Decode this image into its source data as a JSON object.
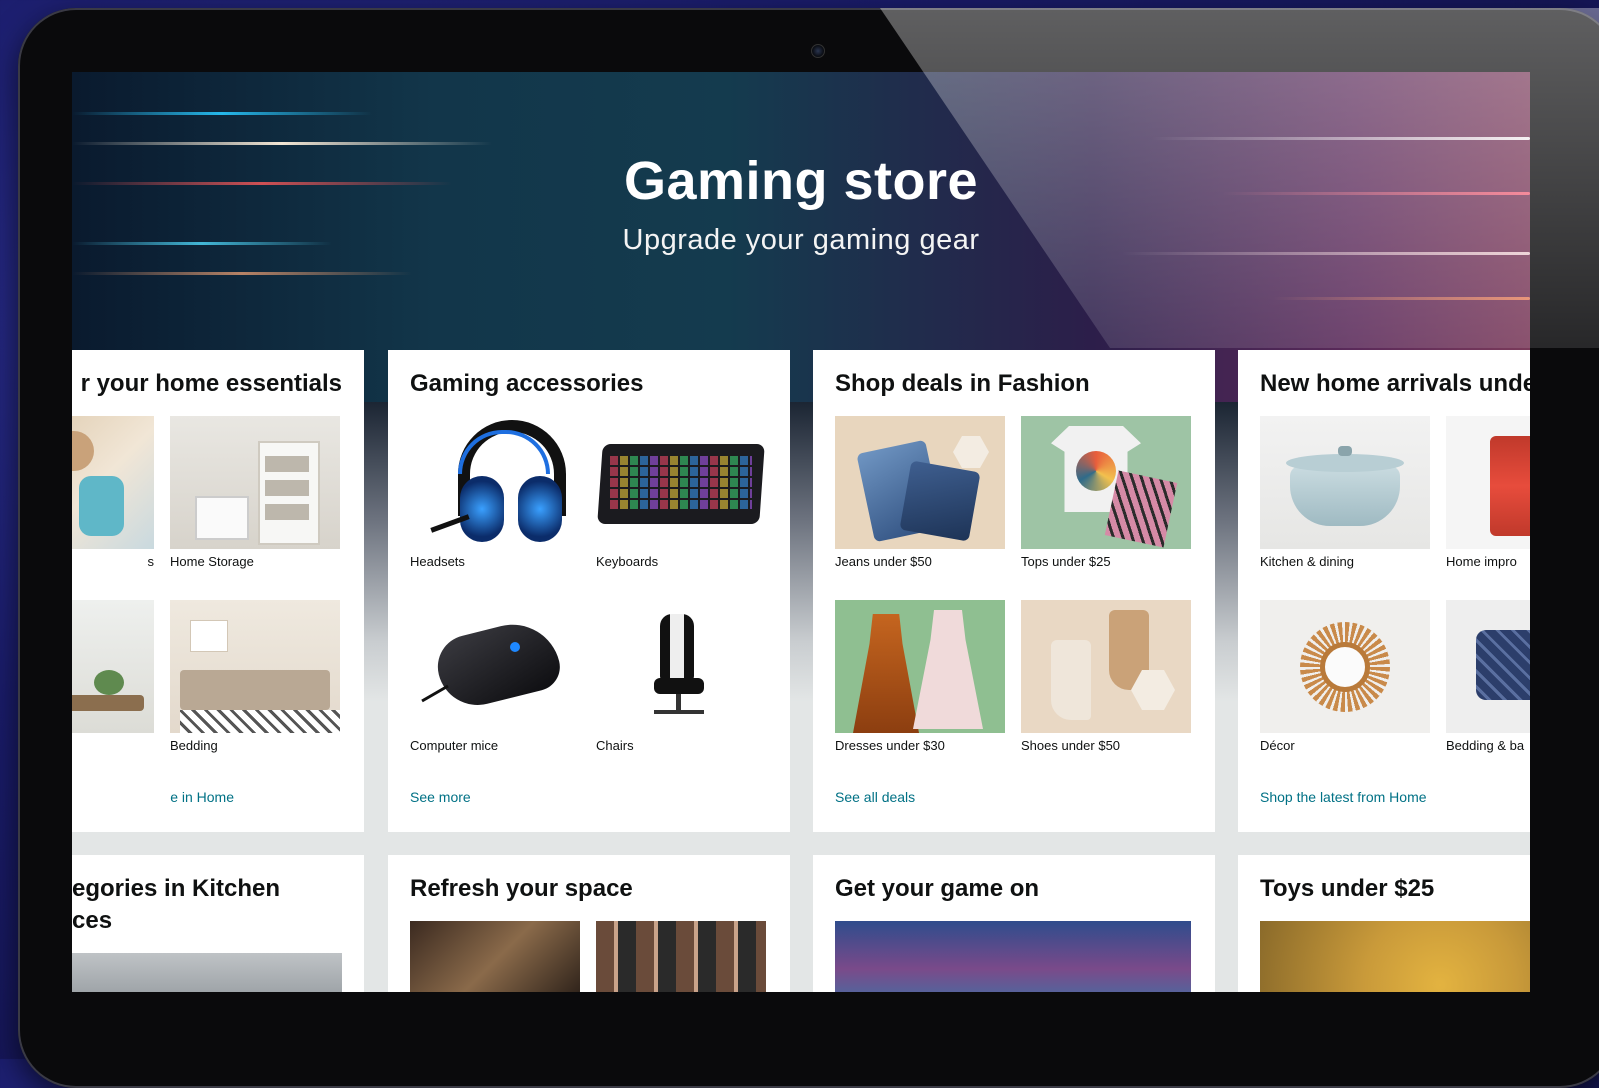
{
  "hero": {
    "title": "Gaming store",
    "subtitle": "Upgrade your gaming gear"
  },
  "cards_row1": [
    {
      "title": "r your home essentials",
      "tiles": [
        {
          "label": "s",
          "icon": "cleaning-image"
        },
        {
          "label": "Home Storage",
          "icon": "storage-shelves-image"
        },
        {
          "label": "",
          "icon": "plant-decor-image"
        },
        {
          "label": "Bedding",
          "icon": "bed-image"
        }
      ],
      "link": "e in Home"
    },
    {
      "title": "Gaming accessories",
      "tiles": [
        {
          "label": "Headsets",
          "icon": "headset-image"
        },
        {
          "label": "Keyboards",
          "icon": "keyboard-image"
        },
        {
          "label": "Computer mice",
          "icon": "mouse-image"
        },
        {
          "label": "Chairs",
          "icon": "gaming-chair-image"
        }
      ],
      "link": "See more"
    },
    {
      "title": "Shop deals in Fashion",
      "tiles": [
        {
          "label": "Jeans under $50",
          "icon": "jeans-image"
        },
        {
          "label": "Tops under $25",
          "icon": "tops-image"
        },
        {
          "label": "Dresses under $30",
          "icon": "dresses-image"
        },
        {
          "label": "Shoes under $50",
          "icon": "boots-image"
        }
      ],
      "link": "See all deals"
    },
    {
      "title": "New home arrivals unde",
      "tiles": [
        {
          "label": "Kitchen & dining",
          "icon": "dutch-oven-image"
        },
        {
          "label": "Home impro",
          "icon": "cans-image"
        },
        {
          "label": "Décor",
          "icon": "sunburst-mirror-image"
        },
        {
          "label": "Bedding & ba",
          "icon": "pillow-image"
        }
      ],
      "link": "Shop the latest from Home"
    }
  ],
  "cards_row2": [
    {
      "title_line1": "egories in Kitchen",
      "title_line2": "ces"
    },
    {
      "title_line1": "Refresh your space"
    },
    {
      "title_line1": "Get your game on"
    },
    {
      "title_line1": "Toys under $25"
    }
  ],
  "colors": {
    "link": "#007185",
    "card_bg": "#ffffff",
    "page_bg": "#e3e6e6",
    "bezel": "#0a0a0c"
  }
}
